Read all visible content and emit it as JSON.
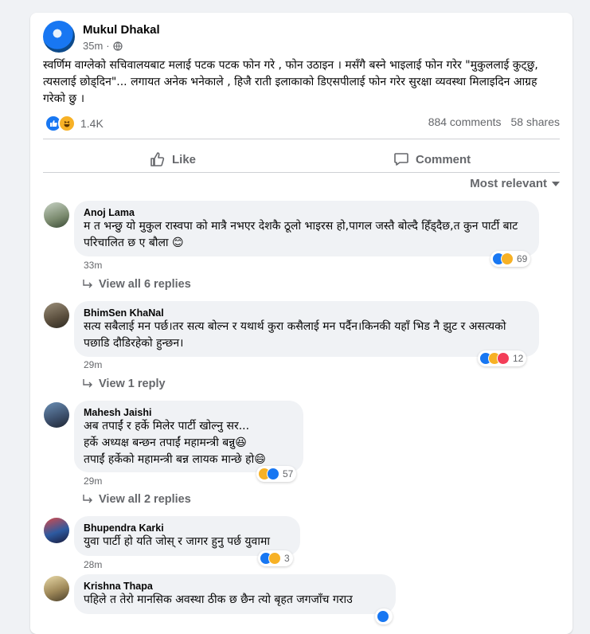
{
  "post": {
    "author": "Mukul Dhakal",
    "time": "35m",
    "text": "स्वर्णिम वाग्लेको सचिवालयबाट मलाई पटक पटक फोन गरे , फोन उठाइन । मसँगै बस्ने भाइलाई फोन गरेर \"मुकुललाई कुट्छु, त्यसलाई छोड्दिन\"... लगायत अनेक भनेकाले , हिजै राती इलाकाको डिएसपीलाई फोन गरेर सुरक्षा व्यवस्था मिलाइदिन आग्रह गरेको छु ।",
    "reaction_count": "1.4K",
    "comments_count": "884 comments",
    "shares_count": "58 shares"
  },
  "actions": {
    "like": "Like",
    "comment": "Comment"
  },
  "sort_label": "Most relevant",
  "comments": [
    {
      "name": "Anoj Lama",
      "text": "म त भन्छु यो मुकुल रास्वपा को मात्रै नभएर देशकै ठूलो भाइरस हो,पागल जस्तै बोल्दै हिँड्दैछ,त कुन पार्टी बाट परिचालित छ ए बौला 😊",
      "time": "33m",
      "reactions": "69",
      "replies": "View all 6 replies"
    },
    {
      "name": "BhimSen KhaNal",
      "text": "सत्य सबैलाई मन पर्छ।तर सत्य बोल्न र यथार्थ कुरा कसैलाई मन पर्दैन।किनकी यहाँ भिड नै झुट र असत्यको पछाडि दौडिरहेको हुन्छन।",
      "time": "29m",
      "reactions": "12",
      "replies": "View 1 reply"
    },
    {
      "name": "Mahesh Jaishi",
      "text": "अब तपाईं र हर्के मिलेर पार्टी खोल्नु सर...\nहर्के अध्यक्ष बन्छन तपाईं महामन्त्री बन्नु😆\nतपाईं हर्केको महामन्त्री बन्न लायक मान्छे हो😄",
      "time": "29m",
      "reactions": "57",
      "replies": "View all 2 replies"
    },
    {
      "name": "Bhupendra Karki",
      "text": "युवा पार्टी हो यति जोस् र जागर हुनु पर्छ युवामा",
      "time": "28m",
      "reactions": "3"
    },
    {
      "name": "Krishna Thapa",
      "text": "पहिले त तेरो मानसिक अवस्था ठीक छ छैन त्यो बृहत जगजाँच गराउ"
    }
  ]
}
